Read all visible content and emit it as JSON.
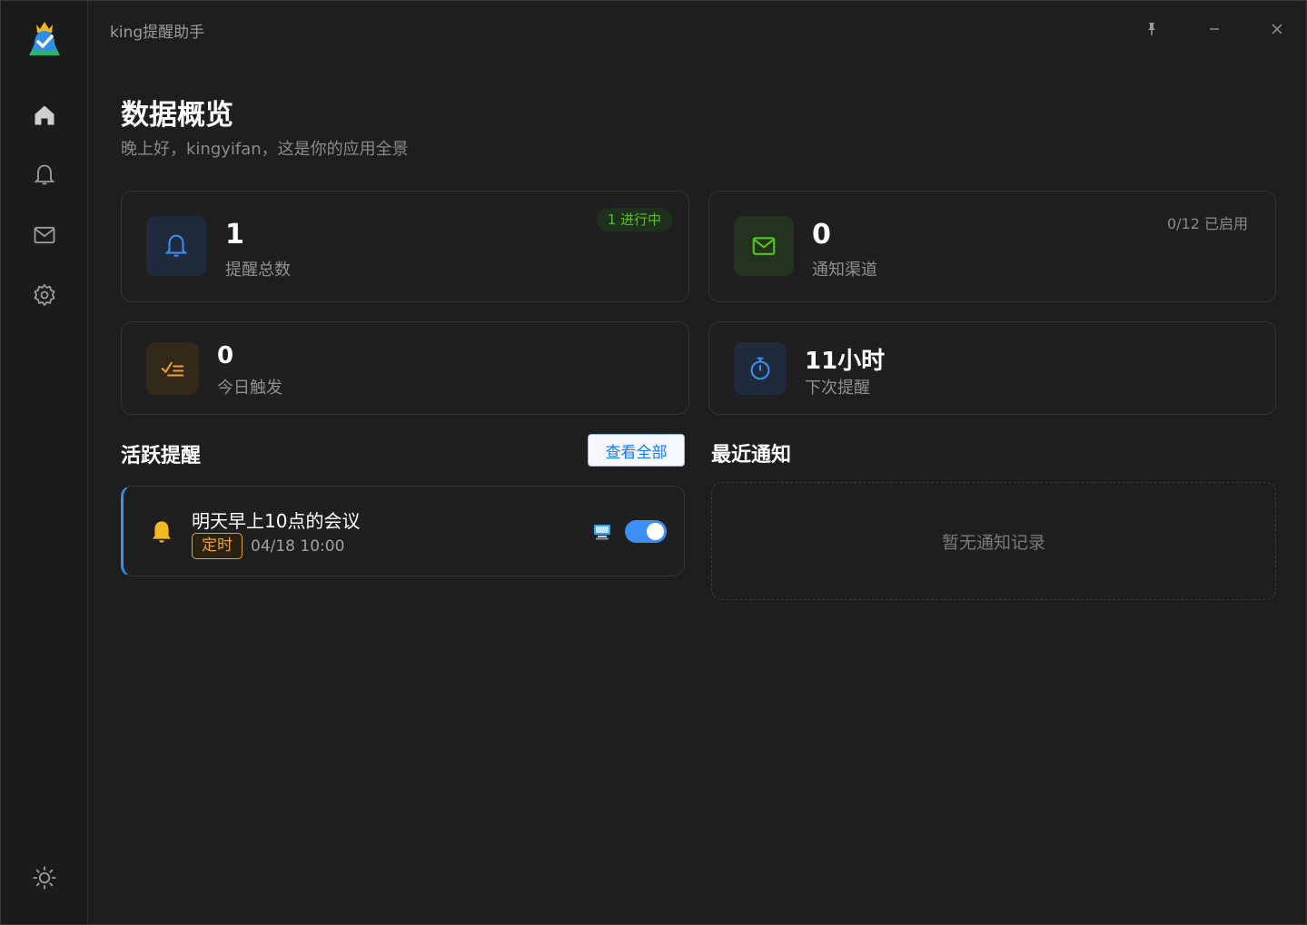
{
  "app": {
    "title": "king提醒助手"
  },
  "sidebar": {
    "items": [
      {
        "name": "home",
        "icon": "home-icon"
      },
      {
        "name": "reminders",
        "icon": "bell-icon"
      },
      {
        "name": "channels",
        "icon": "mail-icon"
      },
      {
        "name": "settings",
        "icon": "gear-icon"
      }
    ],
    "theme_icon": "sun-icon"
  },
  "header": {
    "title": "数据概览",
    "subtitle": "晚上好，kingyifan，这是你的应用全景"
  },
  "stats": {
    "total": {
      "value": "1",
      "label": "提醒总数",
      "badge": "1 进行中",
      "icon": "bell-icon"
    },
    "channels": {
      "value": "0",
      "label": "通知渠道",
      "badge": "0/12 已启用",
      "icon": "mail-icon"
    },
    "today": {
      "value": "0",
      "label": "今日触发",
      "icon": "list-check-icon"
    },
    "next": {
      "value": "11小时",
      "label": "下次提醒",
      "icon": "stopwatch-icon"
    }
  },
  "active": {
    "title": "活跃提醒",
    "view_all": "查看全部",
    "items": [
      {
        "title": "明天早上10点的会议",
        "tag": "定时",
        "time": "04/18 10:00",
        "enabled": true
      }
    ]
  },
  "recent": {
    "title": "最近通知",
    "empty": "暂无通知记录"
  },
  "colors": {
    "accent": "#3b8ff7",
    "success": "#52c41a",
    "warning": "#f0a030",
    "background": "#1e1e1e"
  }
}
